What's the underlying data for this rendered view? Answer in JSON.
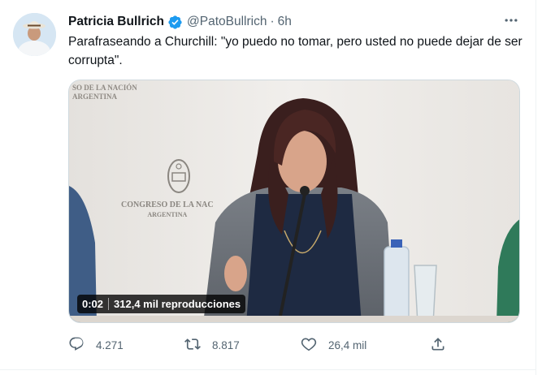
{
  "tweet": {
    "display_name": "Patricia Bullrich",
    "handle": "@PatoBullrich",
    "separator": "·",
    "time": "6h",
    "text": "Parafraseando a Churchill: \"yo puedo no tomar, pero usted no puede dejar de ser corrupta\".",
    "verified": true
  },
  "media": {
    "type": "video",
    "duration": "0:02",
    "views": "312,4 mil reproducciones",
    "background_signs": {
      "top_left_line1": "SO DE LA NACIÓN",
      "top_left_line2": "ARGENTINA",
      "center_line1": "CONGRESO DE LA NAC",
      "center_line2": "ARGENTINA"
    }
  },
  "actions": {
    "reply_count": "4.271",
    "retweet_count": "8.817",
    "like_count": "26,4 mil"
  },
  "icons": {
    "verified": "verified-badge-icon",
    "more": "more-options-icon",
    "reply": "reply-icon",
    "retweet": "retweet-icon",
    "like": "like-icon",
    "share": "share-icon"
  },
  "colors": {
    "accent": "#1d9bf0",
    "text_primary": "#0f1419",
    "text_secondary": "#536471"
  }
}
